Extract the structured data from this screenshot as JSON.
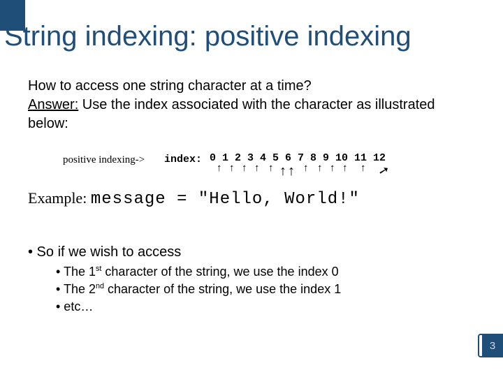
{
  "title": "String indexing: positive indexing",
  "intro": {
    "question": "How to access one string character at a time?",
    "answer_label": "Answer:",
    "answer_text": "  Use the index associated with the character as illustrated below:"
  },
  "diagram": {
    "pi_label": "positive indexing->",
    "index_label": "index:",
    "indices": "0 1 2 3 4 5 6 7 8 9 10 11 12",
    "example_label": "Example:",
    "code_lhs": "message = ",
    "code_rhs": "\"Hello, World!\""
  },
  "bullets": {
    "main": "•  So if we wish to access",
    "sub1_pre": "•  The 1",
    "sub1_sup": "st",
    "sub1_post": " character of the string, we use the index 0",
    "sub2_pre": "•  The 2",
    "sub2_sup": "nd",
    "sub2_post": " character of the string, we use the index 1",
    "sub3": "•  etc…"
  },
  "page_number": "3"
}
